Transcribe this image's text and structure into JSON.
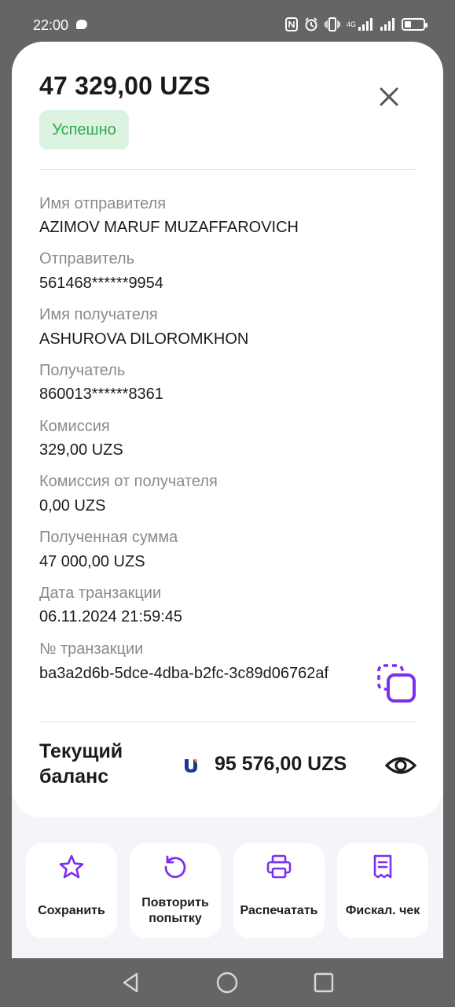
{
  "status_bar": {
    "time": "22:00",
    "icons": [
      "nfc-icon",
      "alarm-icon",
      "vibrate-icon",
      "signal-4g-icon",
      "signal-icon",
      "battery-icon"
    ],
    "network_label": "4G",
    "battery_level": 0.35
  },
  "receipt": {
    "amount": "47 329,00 UZS",
    "status": "Успешно",
    "status_color": "#2fa84f",
    "fields": [
      {
        "label": "Имя отправителя",
        "value": "AZIMOV MARUF MUZAFFAROVICH"
      },
      {
        "label": "Отправитель",
        "value": "561468******9954"
      },
      {
        "label": "Имя получателя",
        "value": "ASHUROVA DILOROMKHON"
      },
      {
        "label": "Получатель",
        "value": "860013******8361"
      },
      {
        "label": "Комиссия",
        "value": "329,00 UZS"
      },
      {
        "label": "Комиссия от получателя",
        "value": "0,00 UZS"
      },
      {
        "label": "Полученная сумма",
        "value": "47 000,00 UZS"
      },
      {
        "label": "Дата транзакции",
        "value": "06.11.2024 21:59:45"
      },
      {
        "label": "№ транзакции",
        "value": "ba3a2d6b-5dce-4dba-b2fc-3c89d06762af"
      }
    ]
  },
  "balance": {
    "label": "Текущий баланс",
    "value": "95 576,00 UZS"
  },
  "actions": [
    {
      "label": "Сохранить",
      "icon": "star-icon"
    },
    {
      "label": "Повторить попытку",
      "icon": "retry-icon"
    },
    {
      "label": "Распечатать",
      "icon": "printer-icon"
    },
    {
      "label": "Фискал. чек",
      "icon": "receipt-icon"
    }
  ],
  "colors": {
    "accent": "#7b2ff0",
    "success_bg": "#ddf3e2",
    "success_text": "#2fa84f"
  }
}
